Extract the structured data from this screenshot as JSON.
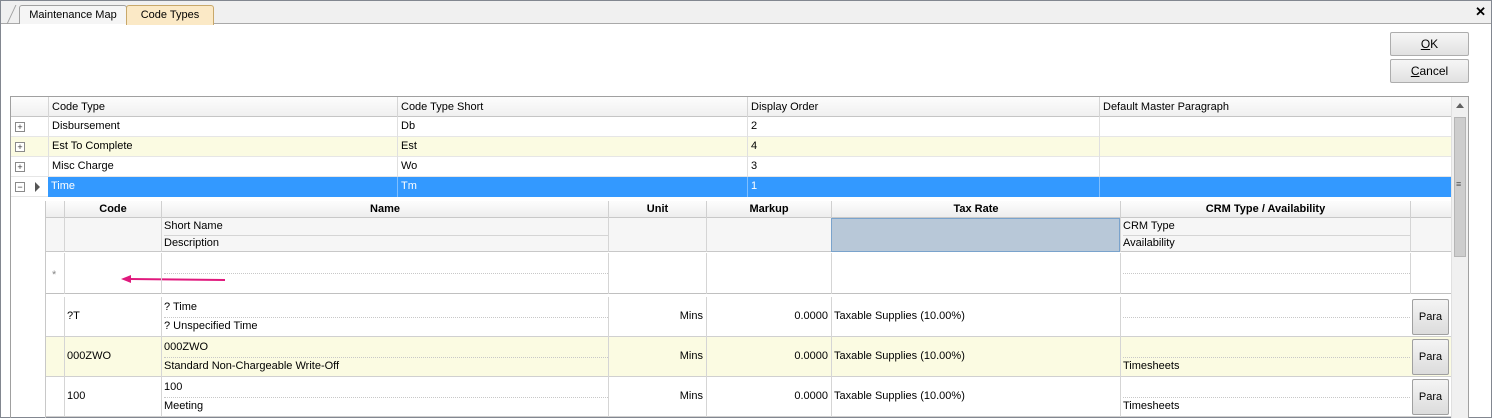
{
  "tabs": [
    {
      "label": "Maintenance Map",
      "active": false
    },
    {
      "label": "Code Types",
      "active": true
    }
  ],
  "buttons": {
    "ok": "OK",
    "ok_accel": "O",
    "ok_rest": "K",
    "cancel_accel": "C",
    "cancel_rest": "ancel"
  },
  "master": {
    "columns": [
      "Code Type",
      "Code Type Short",
      "Display Order",
      "Default Master Paragraph"
    ],
    "rows": [
      {
        "code_type": "Disbursement",
        "short": "Db",
        "order": "2",
        "paragraph": "",
        "style": "normal"
      },
      {
        "code_type": "Est To Complete",
        "short": "Est",
        "order": "4",
        "paragraph": "",
        "style": "yellow"
      },
      {
        "code_type": "Misc Charge",
        "short": "Wo",
        "order": "3",
        "paragraph": "",
        "style": "normal"
      },
      {
        "code_type": "Time",
        "short": "Tm",
        "order": "1",
        "paragraph": "",
        "style": "selected"
      }
    ]
  },
  "child": {
    "columns": [
      "Code",
      "Name",
      "Unit",
      "Markup",
      "Tax Rate",
      "CRM Type / Availability"
    ],
    "sub_labels": {
      "name_top": "Short Name",
      "name_bottom": "Description",
      "crm_top": "CRM Type",
      "crm_bottom": "Availability"
    },
    "new_row_marker": "*",
    "rows": [
      {
        "code": "?T",
        "short_name": "? Time",
        "description": "? Unspecified Time",
        "unit": "Mins",
        "markup": "0.0000",
        "tax": "Taxable Supplies (10.00%)",
        "crm": "",
        "availability": "",
        "button": "Para",
        "style": "normal"
      },
      {
        "code": "000ZWO",
        "short_name": "000ZWO",
        "description": "Standard Non-Chargeable Write-Off",
        "unit": "Mins",
        "markup": "0.0000",
        "tax": "Taxable Supplies (10.00%)",
        "crm": "",
        "availability": "Timesheets",
        "button": "Para",
        "style": "yellow"
      },
      {
        "code": "100",
        "short_name": "100",
        "description": "Meeting",
        "unit": "Mins",
        "markup": "0.0000",
        "tax": "Taxable Supplies (10.00%)",
        "crm": "",
        "availability": "Timesheets",
        "button": "Para",
        "style": "normal"
      }
    ]
  },
  "colors": {
    "selected_row": "#3399ff",
    "alt_row": "#fbfbe2",
    "active_tab": "#fbe9c6",
    "annotation_arrow": "#e0197d"
  }
}
